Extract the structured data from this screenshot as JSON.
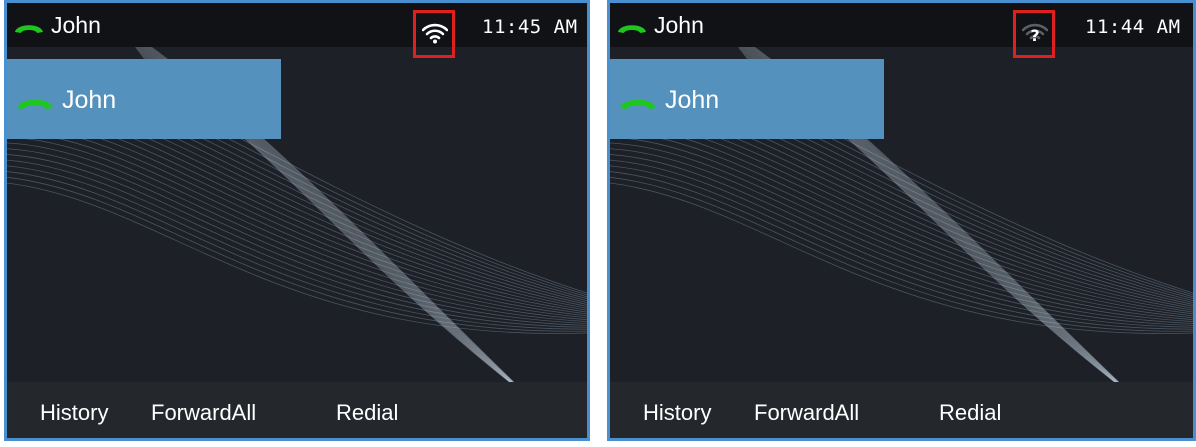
{
  "screens": [
    {
      "status_bar": {
        "line_name": "John",
        "time": "11:45 AM",
        "network_icon": "wifi-icon"
      },
      "line_key": {
        "label": "John",
        "icon": "phone-icon"
      },
      "softkeys": [
        "History",
        "ForwardAll",
        "Redial"
      ]
    },
    {
      "status_bar": {
        "line_name": "John",
        "time": "11:44 AM",
        "network_icon": "wifi-unknown-icon"
      },
      "line_key": {
        "label": "John",
        "icon": "phone-icon"
      },
      "softkeys": [
        "History",
        "ForwardAll",
        "Redial"
      ]
    }
  ],
  "colors": {
    "background": "#1d2026",
    "line_key_highlight": "#5591bd",
    "phone_icon": "#1fc61f",
    "highlight_box": "#e0201f",
    "frame_border": "#4a8fcf"
  }
}
